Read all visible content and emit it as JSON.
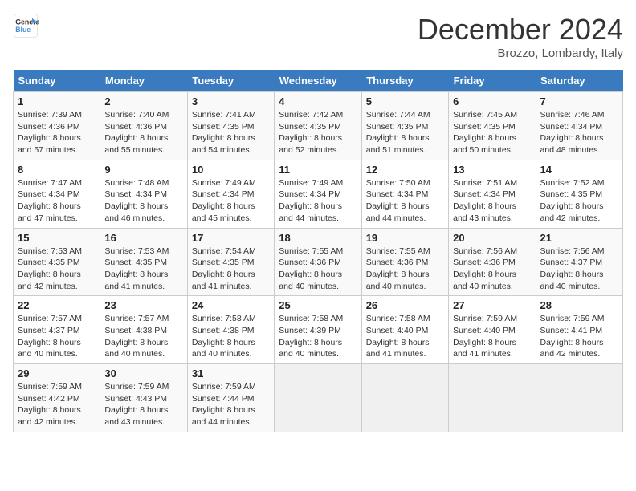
{
  "logo": {
    "line1": "General",
    "line2": "Blue"
  },
  "title": "December 2024",
  "subtitle": "Brozzo, Lombardy, Italy",
  "days_of_week": [
    "Sunday",
    "Monday",
    "Tuesday",
    "Wednesday",
    "Thursday",
    "Friday",
    "Saturday"
  ],
  "weeks": [
    [
      {
        "day": "1",
        "sunrise": "7:39 AM",
        "sunset": "4:36 PM",
        "daylight": "8 hours and 57 minutes."
      },
      {
        "day": "2",
        "sunrise": "7:40 AM",
        "sunset": "4:36 PM",
        "daylight": "8 hours and 55 minutes."
      },
      {
        "day": "3",
        "sunrise": "7:41 AM",
        "sunset": "4:35 PM",
        "daylight": "8 hours and 54 minutes."
      },
      {
        "day": "4",
        "sunrise": "7:42 AM",
        "sunset": "4:35 PM",
        "daylight": "8 hours and 52 minutes."
      },
      {
        "day": "5",
        "sunrise": "7:44 AM",
        "sunset": "4:35 PM",
        "daylight": "8 hours and 51 minutes."
      },
      {
        "day": "6",
        "sunrise": "7:45 AM",
        "sunset": "4:35 PM",
        "daylight": "8 hours and 50 minutes."
      },
      {
        "day": "7",
        "sunrise": "7:46 AM",
        "sunset": "4:34 PM",
        "daylight": "8 hours and 48 minutes."
      }
    ],
    [
      {
        "day": "8",
        "sunrise": "7:47 AM",
        "sunset": "4:34 PM",
        "daylight": "8 hours and 47 minutes."
      },
      {
        "day": "9",
        "sunrise": "7:48 AM",
        "sunset": "4:34 PM",
        "daylight": "8 hours and 46 minutes."
      },
      {
        "day": "10",
        "sunrise": "7:49 AM",
        "sunset": "4:34 PM",
        "daylight": "8 hours and 45 minutes."
      },
      {
        "day": "11",
        "sunrise": "7:49 AM",
        "sunset": "4:34 PM",
        "daylight": "8 hours and 44 minutes."
      },
      {
        "day": "12",
        "sunrise": "7:50 AM",
        "sunset": "4:34 PM",
        "daylight": "8 hours and 44 minutes."
      },
      {
        "day": "13",
        "sunrise": "7:51 AM",
        "sunset": "4:34 PM",
        "daylight": "8 hours and 43 minutes."
      },
      {
        "day": "14",
        "sunrise": "7:52 AM",
        "sunset": "4:35 PM",
        "daylight": "8 hours and 42 minutes."
      }
    ],
    [
      {
        "day": "15",
        "sunrise": "7:53 AM",
        "sunset": "4:35 PM",
        "daylight": "8 hours and 42 minutes."
      },
      {
        "day": "16",
        "sunrise": "7:53 AM",
        "sunset": "4:35 PM",
        "daylight": "8 hours and 41 minutes."
      },
      {
        "day": "17",
        "sunrise": "7:54 AM",
        "sunset": "4:35 PM",
        "daylight": "8 hours and 41 minutes."
      },
      {
        "day": "18",
        "sunrise": "7:55 AM",
        "sunset": "4:36 PM",
        "daylight": "8 hours and 40 minutes."
      },
      {
        "day": "19",
        "sunrise": "7:55 AM",
        "sunset": "4:36 PM",
        "daylight": "8 hours and 40 minutes."
      },
      {
        "day": "20",
        "sunrise": "7:56 AM",
        "sunset": "4:36 PM",
        "daylight": "8 hours and 40 minutes."
      },
      {
        "day": "21",
        "sunrise": "7:56 AM",
        "sunset": "4:37 PM",
        "daylight": "8 hours and 40 minutes."
      }
    ],
    [
      {
        "day": "22",
        "sunrise": "7:57 AM",
        "sunset": "4:37 PM",
        "daylight": "8 hours and 40 minutes."
      },
      {
        "day": "23",
        "sunrise": "7:57 AM",
        "sunset": "4:38 PM",
        "daylight": "8 hours and 40 minutes."
      },
      {
        "day": "24",
        "sunrise": "7:58 AM",
        "sunset": "4:38 PM",
        "daylight": "8 hours and 40 minutes."
      },
      {
        "day": "25",
        "sunrise": "7:58 AM",
        "sunset": "4:39 PM",
        "daylight": "8 hours and 40 minutes."
      },
      {
        "day": "26",
        "sunrise": "7:58 AM",
        "sunset": "4:40 PM",
        "daylight": "8 hours and 41 minutes."
      },
      {
        "day": "27",
        "sunrise": "7:59 AM",
        "sunset": "4:40 PM",
        "daylight": "8 hours and 41 minutes."
      },
      {
        "day": "28",
        "sunrise": "7:59 AM",
        "sunset": "4:41 PM",
        "daylight": "8 hours and 42 minutes."
      }
    ],
    [
      {
        "day": "29",
        "sunrise": "7:59 AM",
        "sunset": "4:42 PM",
        "daylight": "8 hours and 42 minutes."
      },
      {
        "day": "30",
        "sunrise": "7:59 AM",
        "sunset": "4:43 PM",
        "daylight": "8 hours and 43 minutes."
      },
      {
        "day": "31",
        "sunrise": "7:59 AM",
        "sunset": "4:44 PM",
        "daylight": "8 hours and 44 minutes."
      },
      null,
      null,
      null,
      null
    ]
  ]
}
